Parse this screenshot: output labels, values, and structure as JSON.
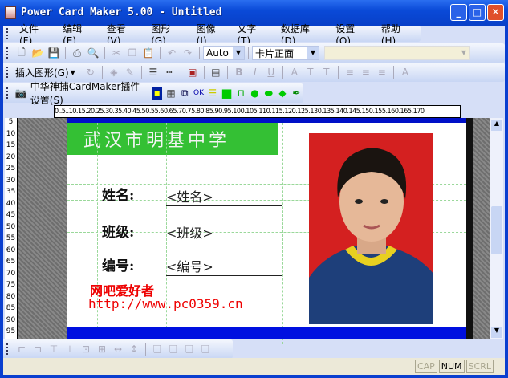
{
  "window": {
    "title": "Power Card Maker 5.00 - Untitled",
    "minimize": "_",
    "maximize": "□",
    "close": "✕"
  },
  "menu": [
    "文件(F)",
    "编辑(E)",
    "查看(V)",
    "图形(G)",
    "图像(I)",
    "文字(T)",
    "数据库(D)",
    "设置(O)",
    "帮助(H)"
  ],
  "toolbar1": {
    "zoom_value": "Auto",
    "side_value": "卡片正面"
  },
  "toolbar2": {
    "insert_shape": "插入图形(G)"
  },
  "toolbar3": {
    "plugin_settings": "中华神捕CardMaker插件设置(S)",
    "ok_label": "OK"
  },
  "ruler_top": "0..5..10.15.20.25.30.35.40.45.50.55.60.65.70.75.80.85.90.95.100.105.110.115.120.125.130.135.140.145.150.155.160.165.170",
  "ruler_left": [
    "5",
    "10",
    "15",
    "20",
    "25",
    "30",
    "35",
    "40",
    "45",
    "50",
    "55",
    "60",
    "65",
    "70",
    "75",
    "80",
    "85",
    "90",
    "95"
  ],
  "card": {
    "school": "武汉市明基中学",
    "fields": [
      {
        "label": "姓名:",
        "value": "<姓名>"
      },
      {
        "label": "班级:",
        "value": "<班级>"
      },
      {
        "label": "编号:",
        "value": "<编号>"
      }
    ],
    "watermark_name": "网吧爱好者",
    "watermark_url": "http://www.pc0359.cn",
    "colors": {
      "header": "#34c034",
      "bottom_bar": "#0010e0",
      "watermark": "#e00000",
      "photo_bg": "#d42020"
    }
  },
  "status": {
    "cap": "CAP",
    "num": "NUM",
    "scrl": "SCRL"
  }
}
